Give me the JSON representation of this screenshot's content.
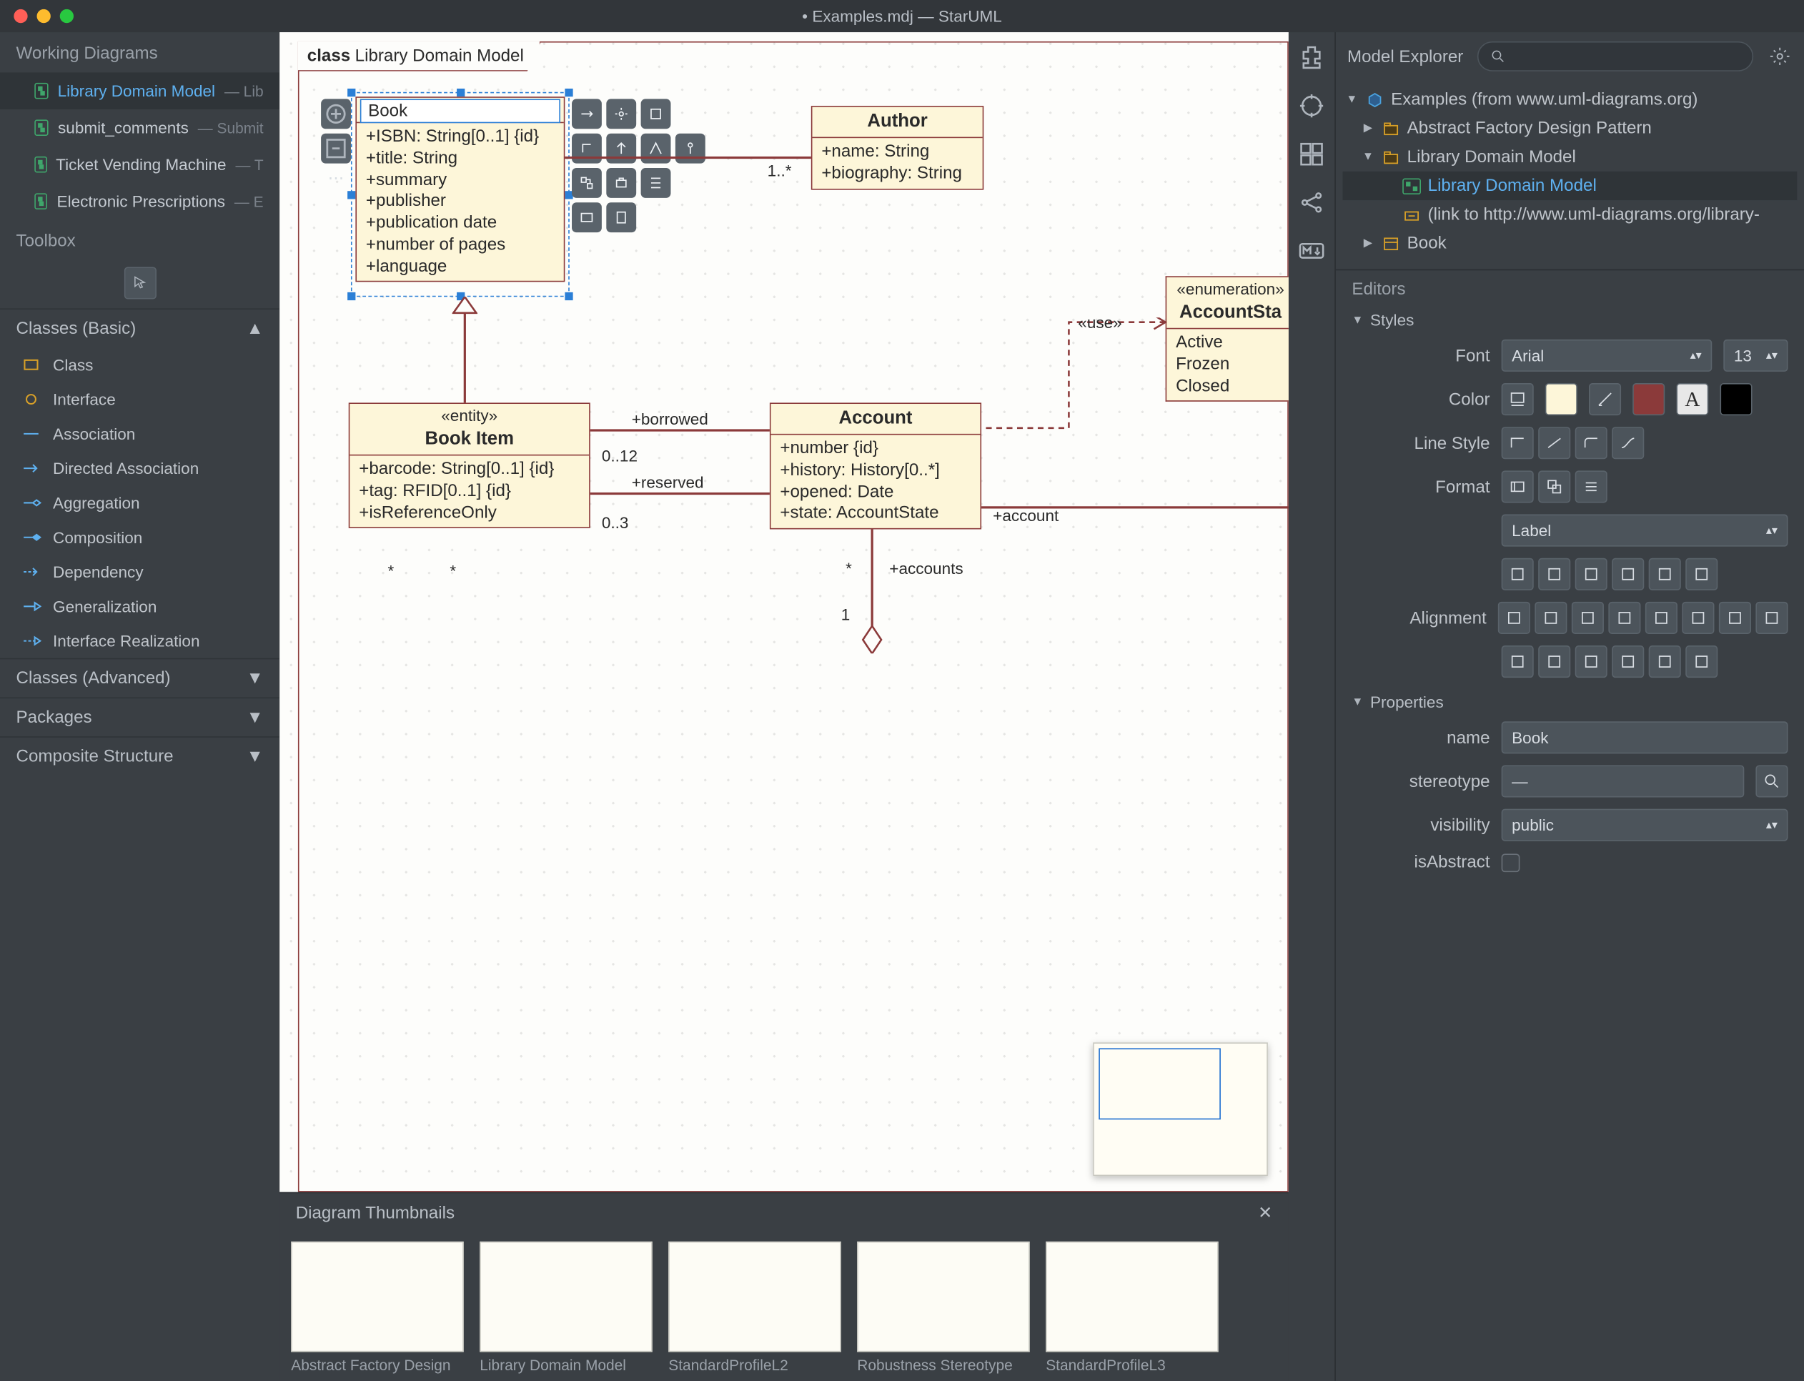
{
  "titlebar": {
    "title": "• Examples.mdj — StarUML"
  },
  "left": {
    "workingDiagramsTitle": "Working Diagrams",
    "items": [
      {
        "label": "Library Domain Model",
        "sub": "— Lib",
        "active": true
      },
      {
        "label": "submit_comments",
        "sub": "— Submit"
      },
      {
        "label": "Ticket Vending Machine",
        "sub": "— T"
      },
      {
        "label": "Electronic Prescriptions",
        "sub": "— E"
      }
    ],
    "toolboxTitle": "Toolbox",
    "sections": [
      {
        "title": "Classes (Basic)",
        "open": true,
        "tools": [
          "Class",
          "Interface",
          "Association",
          "Directed Association",
          "Aggregation",
          "Composition",
          "Dependency",
          "Generalization",
          "Interface Realization"
        ]
      },
      {
        "title": "Classes (Advanced)",
        "open": false
      },
      {
        "title": "Packages",
        "open": false
      },
      {
        "title": "Composite Structure",
        "open": false
      }
    ]
  },
  "canvas": {
    "frameTitleBold": "class",
    "frameTitle": "Library Domain Model",
    "book": {
      "name": "Book",
      "attrs": [
        "+ISBN: String[0..1] {id}",
        "+title: String",
        "+summary",
        "+publisher",
        "+publication date",
        "+number of pages",
        "+language"
      ]
    },
    "author": {
      "name": "Author",
      "attrs": [
        "+name: String",
        "+biography: String"
      ]
    },
    "author_mult": "1..*",
    "bookItem": {
      "stereo": "«entity»",
      "name": "Book Item",
      "attrs": [
        "+barcode: String[0..1] {id}",
        "+tag: RFID[0..1] {id}",
        "+isReferenceOnly"
      ]
    },
    "account": {
      "name": "Account",
      "attrs": [
        "+number {id}",
        "+history: History[0..*]",
        "+opened: Date",
        "+state: AccountState"
      ]
    },
    "enum": {
      "stereo": "«enumeration»",
      "name": "AccountSta",
      "lits": [
        "Active",
        "Frozen",
        "Closed"
      ]
    },
    "labels": {
      "borrowed": "+borrowed",
      "borrowed_m": "0..12",
      "reserved": "+reserved",
      "reserved_m": "0..3",
      "use": "«use»",
      "star1": "*",
      "star2": "*",
      "star3": "*",
      "accounts": "+accounts",
      "account": "+account",
      "one": "1"
    }
  },
  "thumbs": {
    "title": "Diagram Thumbnails",
    "items": [
      "Abstract Factory Design",
      "Library Domain Model",
      "StandardProfileL2",
      "Robustness Stereotype",
      "StandardProfileL3"
    ]
  },
  "rail": {
    "icons": [
      "puzzle",
      "target",
      "grid",
      "share",
      "markdown"
    ]
  },
  "modelExplorer": {
    "title": "Model Explorer",
    "tree": [
      {
        "d": 0,
        "tw": "▼",
        "icon": "cube",
        "label": "Examples (from www.uml-diagrams.org)"
      },
      {
        "d": 1,
        "tw": "▶",
        "icon": "pkg",
        "label": "Abstract Factory Design Pattern"
      },
      {
        "d": 1,
        "tw": "▼",
        "icon": "pkg",
        "label": "Library Domain Model"
      },
      {
        "d": 2,
        "tw": "",
        "icon": "diag",
        "label": "Library Domain Model",
        "active": true
      },
      {
        "d": 2,
        "tw": "",
        "icon": "link",
        "label": "(link to http://www.uml-diagrams.org/library-"
      },
      {
        "d": 1,
        "tw": "▶",
        "icon": "class",
        "label": "Book"
      }
    ]
  },
  "editors": {
    "title": "Editors",
    "stylesTitle": "Styles",
    "fontLabel": "Font",
    "fontValue": "Arial",
    "fontSize": "13",
    "colorLabel": "Color",
    "colors": {
      "fill": "#fdf6d9",
      "line": "#8b3a3a",
      "text": "#000000"
    },
    "lineStyleLabel": "Line Style",
    "formatLabel": "Format",
    "formatSelect": "Label",
    "alignmentLabel": "Alignment",
    "propertiesTitle": "Properties",
    "props": {
      "nameLabel": "name",
      "nameValue": "Book",
      "stereoLabel": "stereotype",
      "stereoValue": "—",
      "visLabel": "visibility",
      "visValue": "public",
      "absLabel": "isAbstract"
    }
  }
}
